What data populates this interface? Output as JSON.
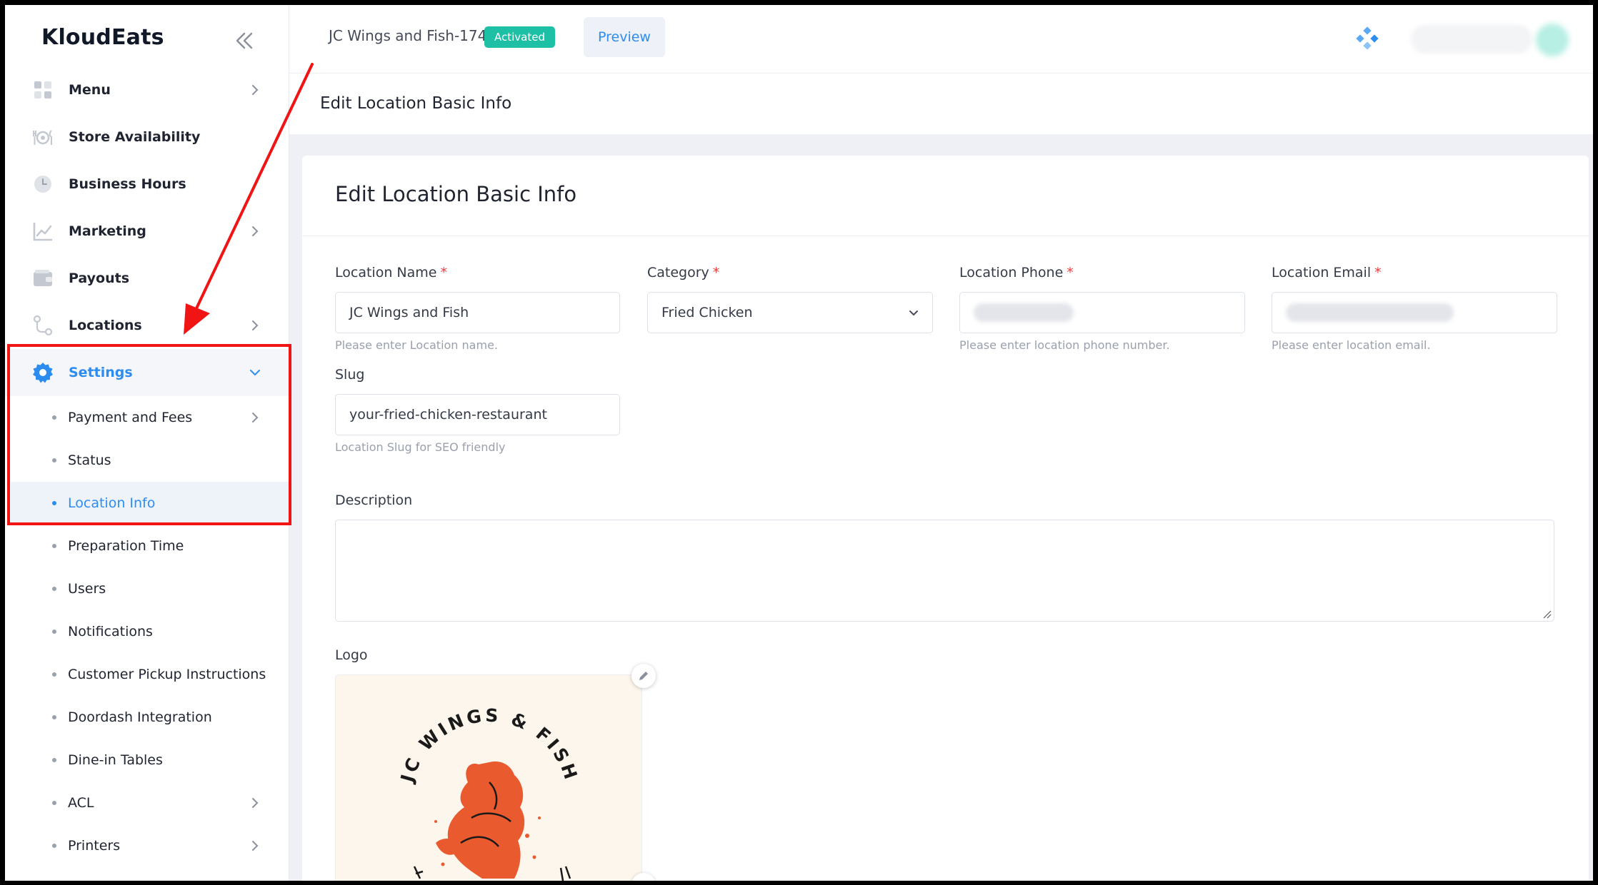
{
  "brand": "KloudEats",
  "sidebar": {
    "items": [
      {
        "label": "Menu",
        "icon": "menu-grid-icon",
        "has_chevron": true
      },
      {
        "label": "Store Availability",
        "icon": "store-availability-icon",
        "has_chevron": false
      },
      {
        "label": "Business Hours",
        "icon": "clock-icon",
        "has_chevron": false
      },
      {
        "label": "Marketing",
        "icon": "chart-line-icon",
        "has_chevron": true
      },
      {
        "label": "Payouts",
        "icon": "wallet-icon",
        "has_chevron": false
      },
      {
        "label": "Locations",
        "icon": "locations-icon",
        "has_chevron": true
      },
      {
        "label": "Settings",
        "icon": "gear-icon",
        "has_chevron": true,
        "expanded": true
      }
    ],
    "settings_sub": [
      {
        "label": "Payment and Fees",
        "has_chevron": true
      },
      {
        "label": "Status",
        "has_chevron": false
      },
      {
        "label": "Location Info",
        "has_chevron": false,
        "active": true
      },
      {
        "label": "Preparation Time",
        "has_chevron": false
      },
      {
        "label": "Users",
        "has_chevron": false
      },
      {
        "label": "Notifications",
        "has_chevron": false
      },
      {
        "label": "Customer Pickup Instructions",
        "has_chevron": false
      },
      {
        "label": "Doordash Integration",
        "has_chevron": false
      },
      {
        "label": "Dine-in Tables",
        "has_chevron": false
      },
      {
        "label": "ACL",
        "has_chevron": true
      },
      {
        "label": "Printers",
        "has_chevron": true
      }
    ]
  },
  "topbar": {
    "store_name": "JC Wings and Fish-174",
    "status_badge": "Activated",
    "preview_label": "Preview"
  },
  "page_header_title": "Edit Location Basic Info",
  "form": {
    "title": "Edit Location Basic Info",
    "location_name": {
      "label": "Location Name",
      "required": "*",
      "value": "JC Wings and Fish",
      "help": "Please enter Location name."
    },
    "category": {
      "label": "Category",
      "required": "*",
      "value": "Fried Chicken"
    },
    "location_phone": {
      "label": "Location Phone",
      "required": "*",
      "help": "Please enter location phone number."
    },
    "location_email": {
      "label": "Location Email",
      "required": "*",
      "help": "Please enter location email."
    },
    "slug": {
      "label": "Slug",
      "value": "your-fried-chicken-restaurant",
      "help": "Location Slug for SEO friendly"
    },
    "description": {
      "label": "Description",
      "value": ""
    },
    "logo": {
      "label": "Logo",
      "logo_text": "JC WINGS & FISH"
    }
  },
  "colors": {
    "accent": "#2d8cf0",
    "badge": "#1dbfa5",
    "annotation_red": "#f01414",
    "logo_orange": "#ea5a2f"
  }
}
